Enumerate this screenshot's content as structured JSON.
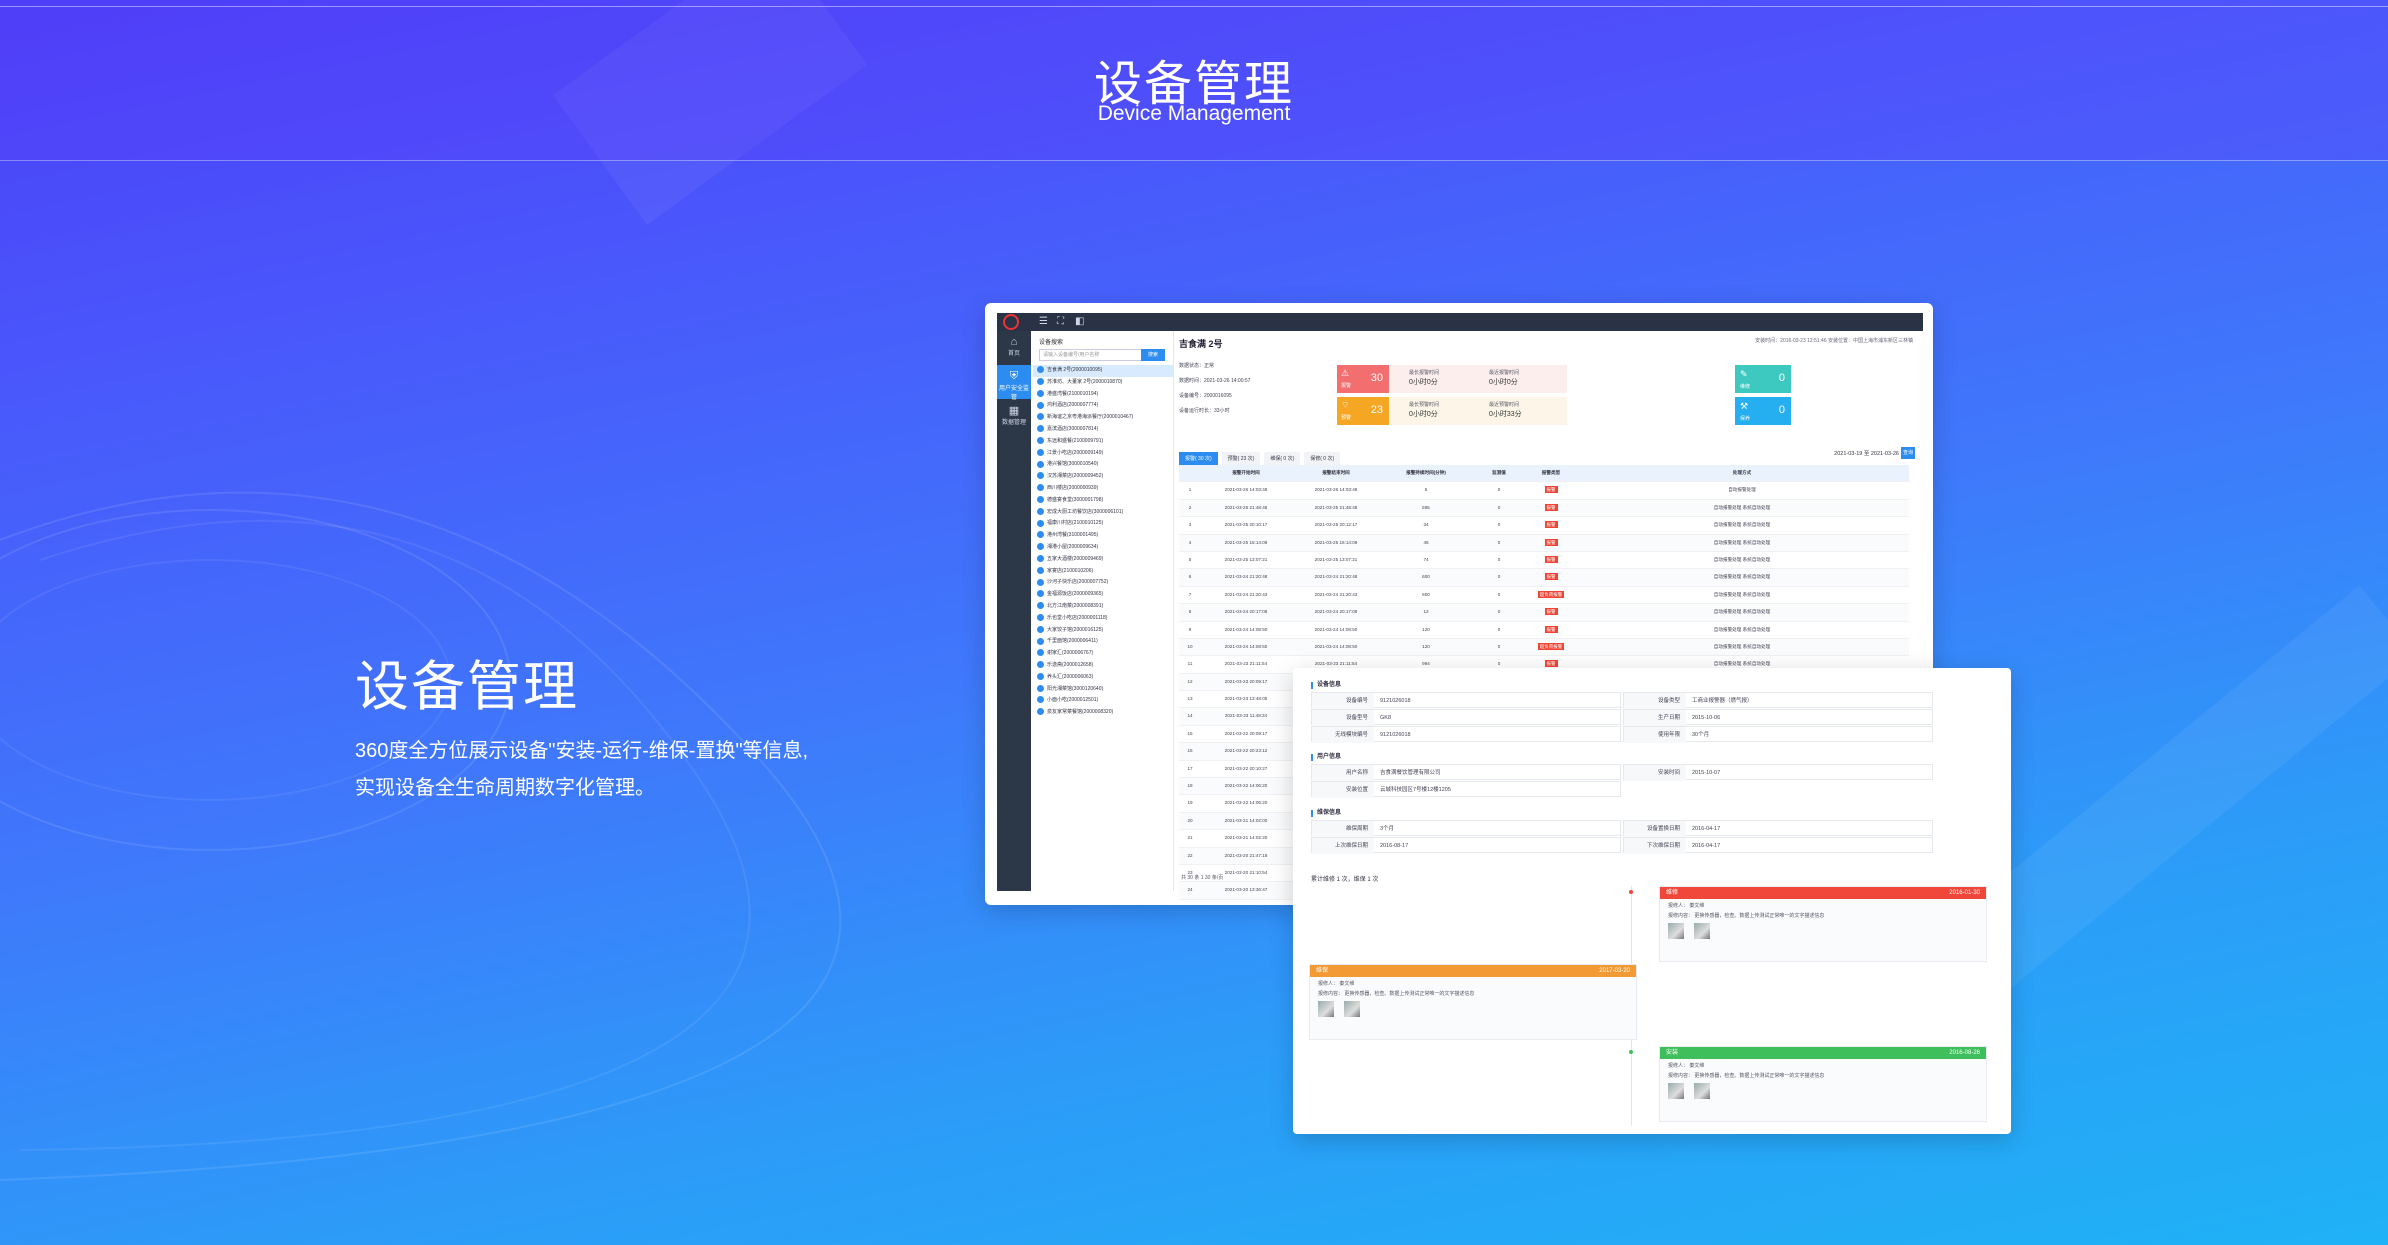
{
  "hero": {
    "title": "设备管理",
    "subtitle": "Device Management"
  },
  "feature": {
    "title": "设备管理",
    "desc_line1": "360度全方位展示设备\"安装-运行-维保-置换\"等信息,",
    "desc_line2": "实现设备全生命周期数字化管理。"
  },
  "app": {
    "sidebar": [
      {
        "label": "首页",
        "icon": "home-icon"
      },
      {
        "label": "用户安全监管",
        "icon": "shield-icon"
      },
      {
        "label": "数据管理",
        "icon": "data-icon"
      }
    ],
    "tree": {
      "heading": "设备搜索",
      "search_placeholder": "请输入设备编号/用户名称",
      "search_button": "搜索",
      "items": [
        "吉食满 2号(2000010095)",
        "苏淮坊、大董家 2号(2000010870)",
        "港盛湾餐(2100010194)",
        "鸿利酒店(2000007774)",
        "新海谊之京粤港海派餐厅(2000010467)",
        "嘉滨酒店(3000007814)",
        "东远和盛餐(2100009791)",
        "江景小吃店(2000009149)",
        "港兴餐馆(3000010540)",
        "汉苏湘菜店(2000009452)",
        "西川楼店(2000000939)",
        "德盛宴食堂(3000001798)",
        "宏成大厨工坊餐饮店(3000006101)",
        "福康川村店(2100010125)",
        "港州湾餐(3100001495)",
        "湘港小屋(2000009634)",
        "五家大酒楼(2000009469)",
        "家宴店(2100010206)",
        "沙河子快乐店(2000007752)",
        "金福源饭店(2000009365)",
        "北方江南菜(2000008391)",
        "乐也堂小吃店(2000001118)",
        "大家饺子馆(2000016125)",
        "千里面馆(2000006411)",
        "谢家汇(2000006767)",
        "乐逸斋(2000012658)",
        "养头汇(2000006063)",
        "阳光湘菜馆(3000120640)",
        "小面小吃(2000012501)",
        "泉友家常菜餐馆(2000008320)"
      ],
      "footer": "共 30 条"
    },
    "main": {
      "title": "吉食满 2号",
      "meta": "安装时间：2016-03-23 12:51:46    安装位置：中国上海市浦东新区三林镇",
      "info": [
        "数据状态：正常",
        "数据时间：2021-03-26 14:00:57",
        "设备编号：2000016095",
        "设备运行时长：33小时"
      ],
      "stats": {
        "alarm_count": "30",
        "alarm_label": "报警",
        "warn_count": "23",
        "warn_label": "预警",
        "repair_count": "0",
        "repair_label": "维修",
        "service_count": "0",
        "service_label": "保养",
        "a1": "最长报警时间",
        "a1v": "0小时0分",
        "a2": "最近报警时间",
        "a2v": "0小时0分",
        "a3": "最长预警时间",
        "a3v": "0小时0分",
        "a4": "最近预警时间",
        "a4v": "0小时33分"
      },
      "tabs": [
        "报警( 30 次)",
        "预警( 23 次)",
        "维保( 0 次)",
        "保修( 0 次)"
      ],
      "date_range": "2021-03-19 至 2021-03-26",
      "date_button": "查询",
      "columns": [
        "",
        "报警开始时间",
        "报警结束时间",
        "报警持续时间(分钟)",
        "监测值",
        "报警类型",
        "处理方式"
      ],
      "rows": [
        [
          "1",
          "2021-03-26 14:03:48",
          "2021-03-26 14:03:48",
          "5",
          "0",
          "报警",
          "自动报警处理"
        ],
        [
          "2",
          "2021-03-25 21:48:48",
          "2021-03-25 21:48:48",
          "595",
          "0",
          "报警",
          "自动报警处理 系统自动处理"
        ],
        [
          "3",
          "2021-03-25 20:10:17",
          "2021-03-25 20:12:17",
          "34",
          "0",
          "报警",
          "自动报警处理 系统自动处理"
        ],
        [
          "4",
          "2021-03-25 15:14:09",
          "2021-03-25 15:14:09",
          "46",
          "0",
          "报警",
          "自动报警处理 系统自动处理"
        ],
        [
          "5",
          "2021-03-25 13:07:21",
          "2021-03-25 13:07:21",
          "74",
          "0",
          "报警",
          "自动报警处理 系统自动处理"
        ],
        [
          "6",
          "2021-03-24 21:20:48",
          "2021-03-24 21:20:48",
          "600",
          "0",
          "报警",
          "自动报警处理 系统自动处理"
        ],
        [
          "7",
          "2021-03-24 21:20:43",
          "2021-03-24 21:20:43",
          "600",
          "0",
          "超负荷报警",
          "自动报警处理 系统自动处理"
        ],
        [
          "8",
          "2021-03-24 20:17:08",
          "2021-03-24 20:17:08",
          "12",
          "0",
          "报警",
          "自动报警处理 系统自动处理"
        ],
        [
          "9",
          "2021-03-24 14:08:50",
          "2021-03-24 14:08:50",
          "120",
          "0",
          "报警",
          "自动报警处理 系统自动处理"
        ],
        [
          "10",
          "2021-03-24 14:08:50",
          "2021-03-24 14:08:50",
          "120",
          "0",
          "超负荷报警",
          "自动报警处理 系统自动处理"
        ],
        [
          "11",
          "2021-03-23 21:11:54",
          "2021-03-23 21:11:54",
          "994",
          "0",
          "报警",
          "自动报警处理 系统自动处理"
        ],
        [
          "12",
          "2021-03-23 20:09:17",
          "",
          "",
          "",
          "",
          ""
        ],
        [
          "13",
          "2021-03-23 13:48:05",
          "",
          "",
          "",
          "",
          ""
        ],
        [
          "14",
          "2021-03-23 11:48:34",
          "",
          "",
          "",
          "",
          ""
        ],
        [
          "15",
          "2021-03-22 20:09:17",
          "",
          "",
          "",
          "",
          ""
        ],
        [
          "16",
          "2021-03-22 20:23:12",
          "",
          "",
          "",
          "",
          ""
        ],
        [
          "17",
          "2021-03-22 20:10:27",
          "",
          "",
          "",
          "",
          ""
        ],
        [
          "18",
          "2021-03-22 14:06:20",
          "",
          "",
          "",
          "",
          ""
        ],
        [
          "19",
          "2021-03-22 14:06:20",
          "",
          "",
          "",
          "",
          ""
        ],
        [
          "20",
          "2021-03-21 14:02:00",
          "",
          "",
          "",
          "",
          ""
        ],
        [
          "21",
          "2021-03-21 14:02:20",
          "",
          "",
          "",
          "",
          ""
        ],
        [
          "22",
          "2021-03-20 21:47:18",
          "",
          "",
          "",
          "",
          ""
        ],
        [
          "23",
          "2021-03-20 21:10:54",
          "",
          "",
          "",
          "",
          ""
        ],
        [
          "24",
          "2021-03-20 13:36:47",
          "",
          "",
          "",
          "",
          ""
        ]
      ],
      "pager": "共 30 条     1     30 条/页"
    },
    "detail": {
      "sec_device": "设备信息",
      "device_rows": [
        [
          "设备编号",
          "9121026018",
          "设备类型",
          "工商业报警器（燃气报）"
        ],
        [
          "设备型号",
          "GK8",
          "生产日期",
          "2015-10-06"
        ],
        [
          "无线模块编号",
          "9121026018",
          "使用年限",
          "30个月"
        ]
      ],
      "sec_user": "用户信息",
      "user_rows": [
        [
          "用户名称",
          "吉食满餐饮管理有限公司",
          "安装时间",
          "2015-10-07"
        ],
        [
          "安装位置",
          "云城科技园区7号楼12楼1205",
          "",
          ""
        ]
      ],
      "sec_service": "维保信息",
      "service_rows": [
        [
          "维保周期",
          "3个月",
          "设备置换日期",
          "2016-04-17"
        ],
        [
          "上次维保日期",
          "2016-08-17",
          "下次维保日期",
          "2016-04-17"
        ]
      ],
      "summary": "累计维修 1 次，维保 1 次",
      "timeline": [
        {
          "type": "维修",
          "date": "2016-01-30",
          "person": "报修人：   秦文维",
          "note": "报修内容：   更换传感器，检查。数据上传测试正常唯一的文字描述信息",
          "color": "#f0473a",
          "side": "right"
        },
        {
          "type": "维保",
          "date": "2017-03-20",
          "person": "报修人：   秦文维",
          "note": "报修内容：   更换传感器，检查。数据上传测试正常唯一的文字描述信息",
          "color": "#f39a34",
          "side": "left"
        },
        {
          "type": "安装",
          "date": "2016-08-26",
          "person": "报修人：   秦文维",
          "note": "报修内容：   更换传感器，检查。数据上传测试正常唯一的文字描述信息",
          "color": "#3fbf5c",
          "side": "right"
        }
      ]
    }
  }
}
